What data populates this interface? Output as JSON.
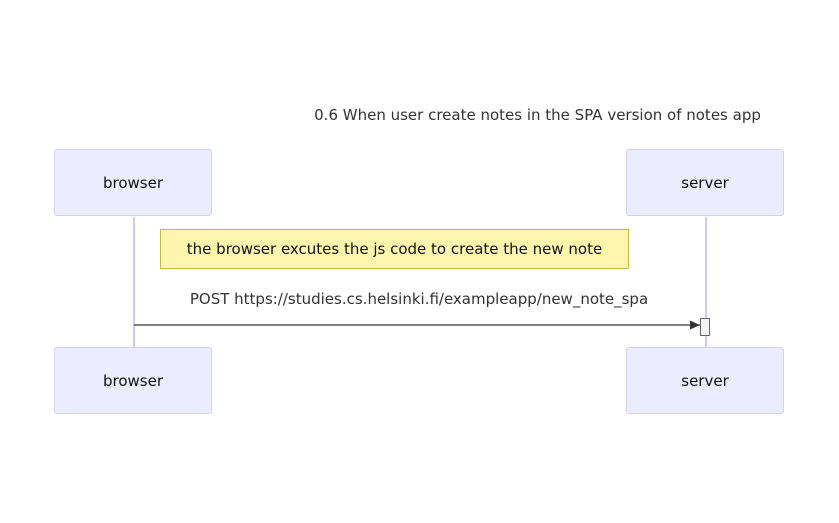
{
  "diagram": {
    "title": "0.6 When user create notes in the SPA version of notes app",
    "participants": {
      "browser": "browser",
      "server": "server"
    },
    "note": "the browser excutes the js code to create the new note",
    "message": {
      "from": "browser",
      "to": "server",
      "label": "POST https://studies.cs.helsinki.fi/exampleapp/new_note_spa"
    },
    "colors": {
      "actor_fill": "#ececff",
      "actor_border": "#d4d0f6",
      "lifeline": "#cfcaf7",
      "note_fill": "#fff5ad",
      "note_border": "#c9b84a",
      "arrow": "#333333"
    }
  }
}
